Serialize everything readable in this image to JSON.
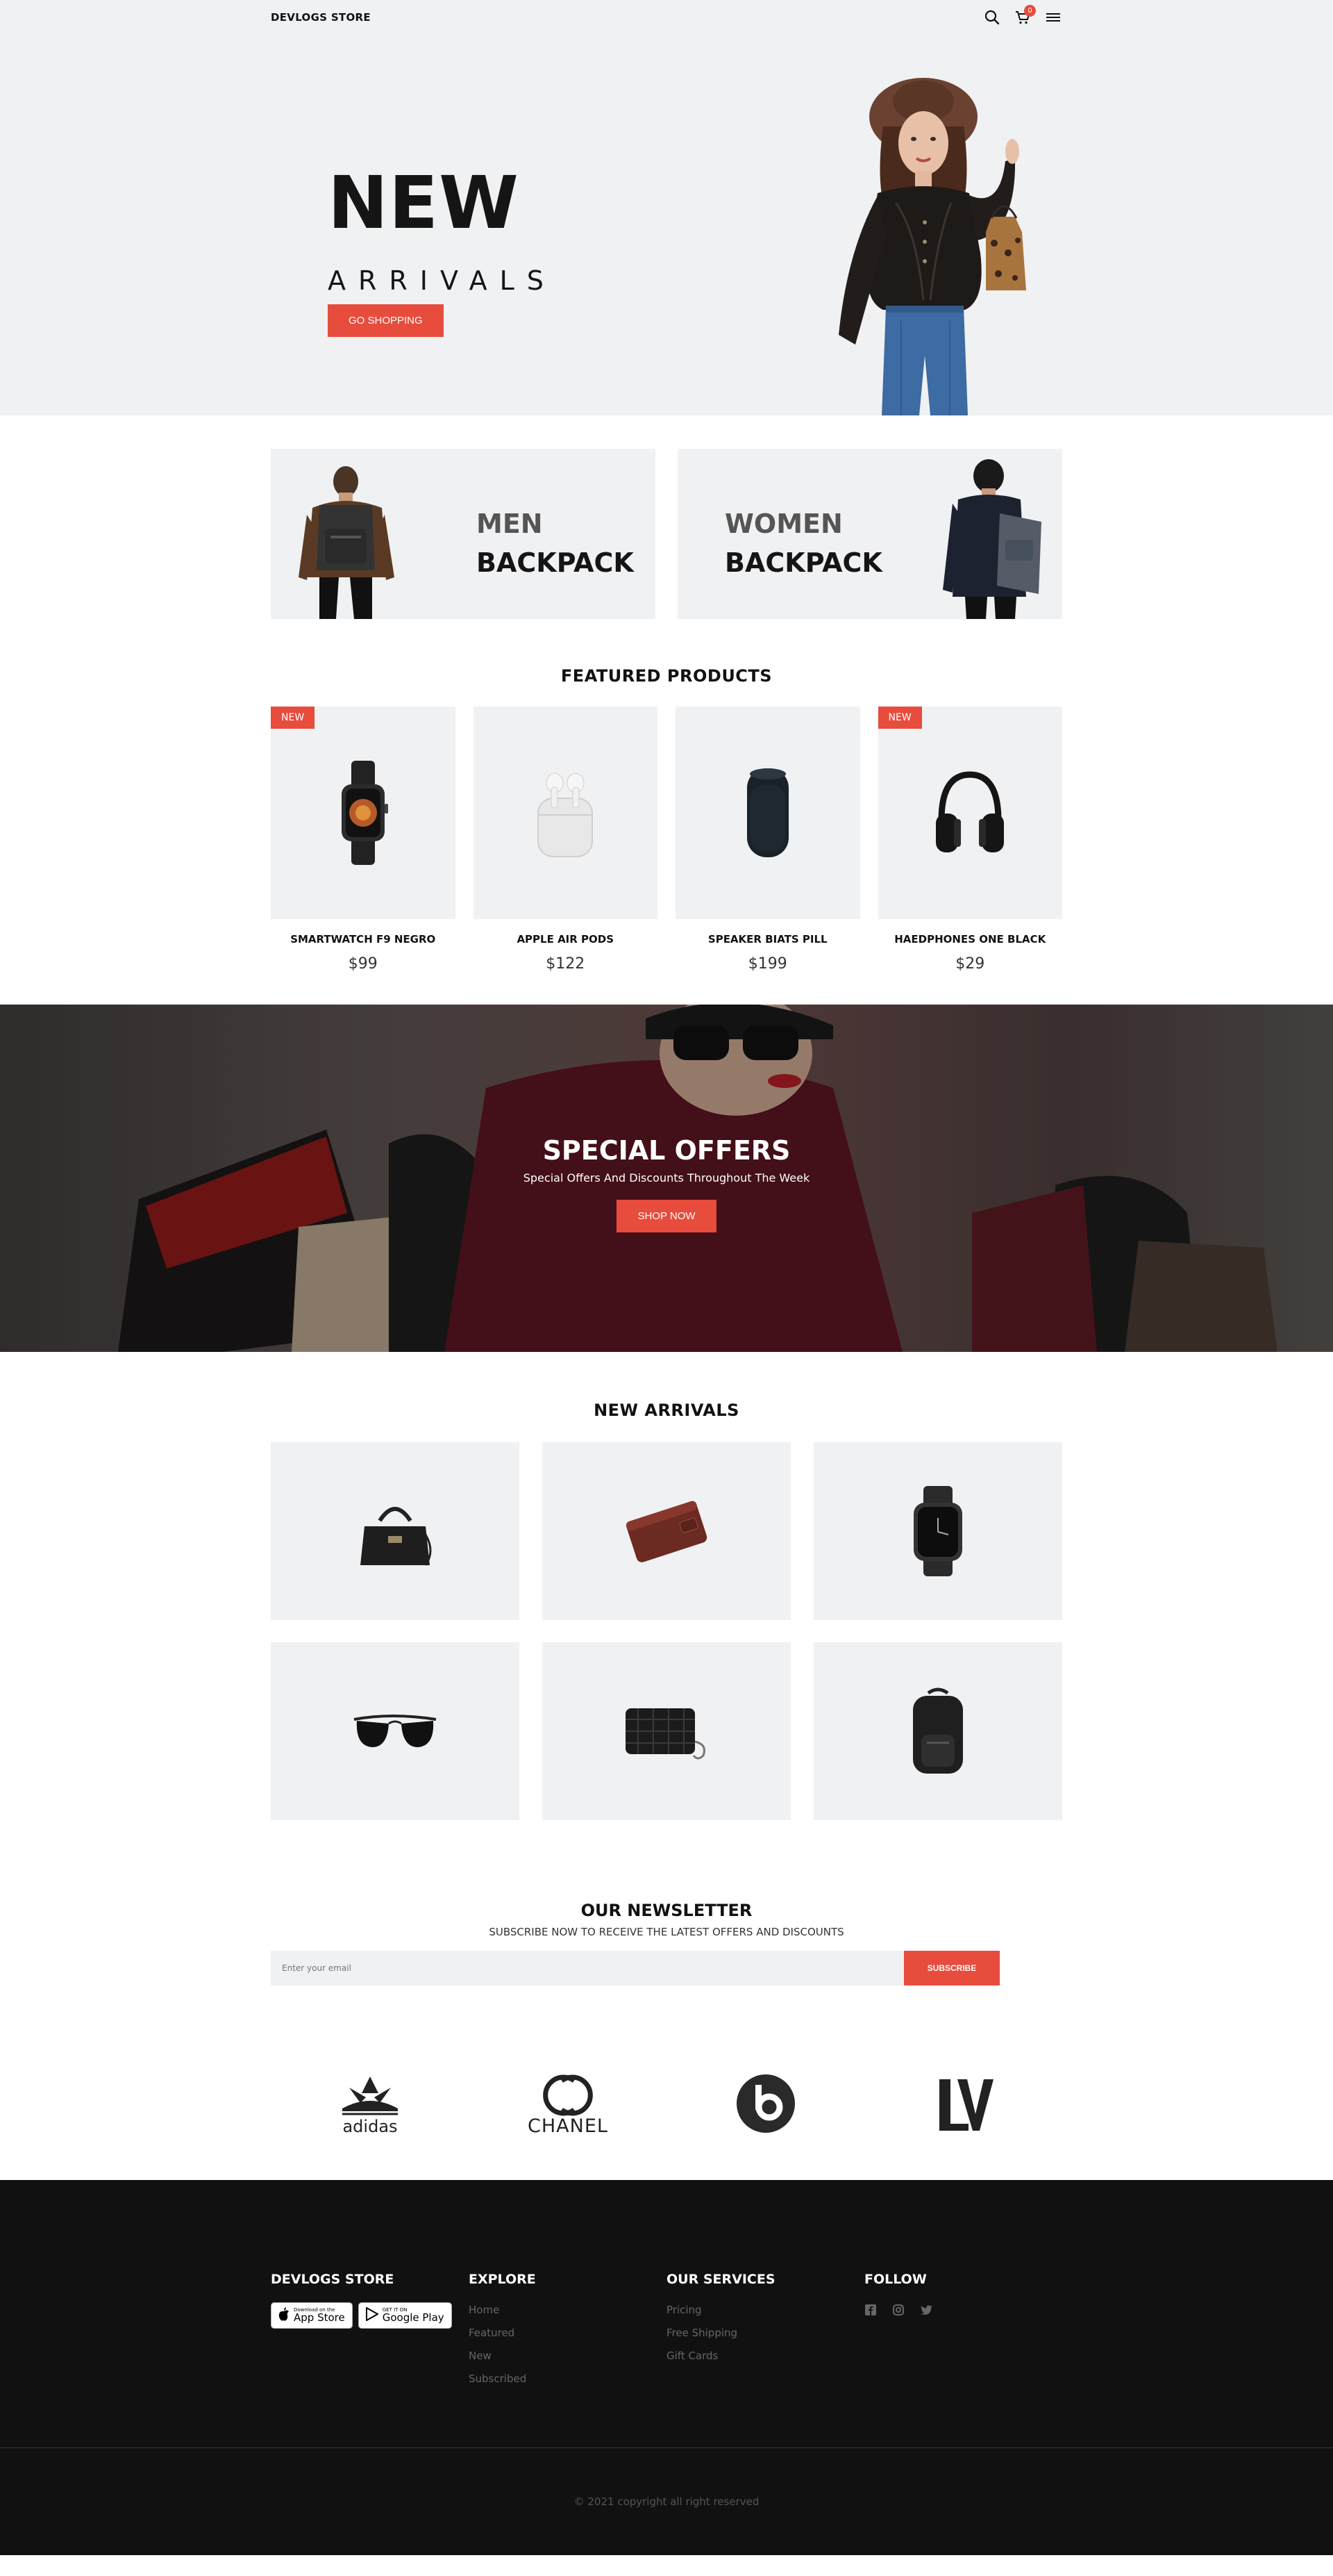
{
  "header": {
    "brand": "DEVLOGS STORE",
    "cart_count": "0",
    "icons": [
      "search-icon",
      "cart-icon",
      "menu-icon"
    ]
  },
  "hero": {
    "title": "NEW",
    "subtitle": "ARRIVALS",
    "button": "GO SHOPPING"
  },
  "backpacks": {
    "men": {
      "line1": "MEN",
      "line2": "BACKPACK"
    },
    "women": {
      "line1": "WOMEN",
      "line2": "BACKPACK"
    }
  },
  "featured": {
    "title": "FEATURED PRODUCTS",
    "items": [
      {
        "name": "SMARTWATCH F9 NEGRO",
        "price": "$99",
        "tag": "NEW"
      },
      {
        "name": "APPLE AIR PODS",
        "price": "$122",
        "tag": ""
      },
      {
        "name": "SPEAKER BIATS PILL",
        "price": "$199",
        "tag": ""
      },
      {
        "name": "HAEDPHONES ONE BLACK",
        "price": "$29",
        "tag": "NEW"
      }
    ]
  },
  "offers": {
    "title": "SPECIAL OFFERS",
    "subtitle": "Special Offers And Discounts Throughout The Week",
    "button": "SHOP NOW"
  },
  "arrivals": {
    "title": "NEW ARRIVALS",
    "items": [
      "handbag",
      "wallet",
      "smartwatch",
      "sunglasses",
      "quilted-clutch",
      "backpack"
    ]
  },
  "newsletter": {
    "title": "OUR NEWSLETTER",
    "subtitle": "SUBSCRIBE NOW TO RECEIVE THE LATEST OFFERS AND DISCOUNTS",
    "placeholder": "Enter your email",
    "button": "SUBSCRIBE"
  },
  "brands": [
    "adidas",
    "CHANEL",
    "beats",
    "LV"
  ],
  "footer": {
    "col1": {
      "title": "DEVLOGS STORE",
      "app_store_small": "Download on the",
      "app_store": "App Store",
      "google_play_small": "GET IT ON",
      "google_play": "Google Play"
    },
    "col2": {
      "title": "EXPLORE",
      "links": [
        "Home",
        "Featured",
        "New",
        "Subscribed"
      ]
    },
    "col3": {
      "title": "OUR SERVICES",
      "links": [
        "Pricing",
        "Free Shipping",
        "Gift Cards"
      ]
    },
    "col4": {
      "title": "FOLLOW",
      "icons": [
        "facebook-icon",
        "instagram-icon",
        "twitter-icon"
      ]
    },
    "copyright": "© 2021 copyright all right reserved"
  },
  "colors": {
    "accent": "#e74c3c",
    "panel": "#f0f1f3",
    "footer": "#111111"
  }
}
